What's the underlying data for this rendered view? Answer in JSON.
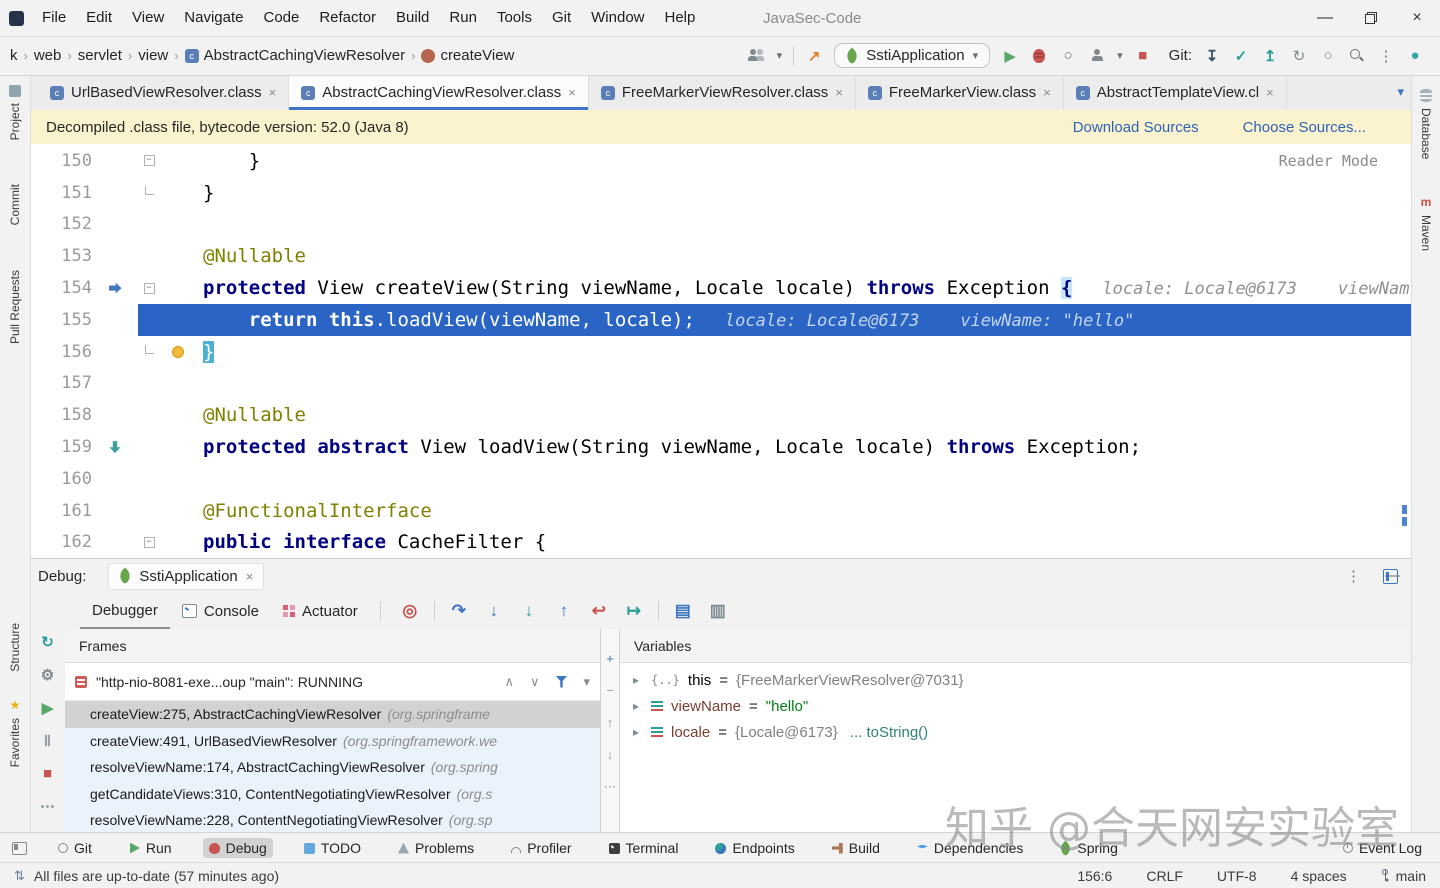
{
  "titlebar": {
    "menus": [
      "File",
      "Edit",
      "View",
      "Navigate",
      "Code",
      "Refactor",
      "Build",
      "Run",
      "Tools",
      "Git",
      "Window",
      "Help"
    ],
    "title": "JavaSec-Code"
  },
  "navbar": {
    "crumbs": [
      {
        "label": "k"
      },
      {
        "label": "web"
      },
      {
        "label": "servlet"
      },
      {
        "label": "view"
      },
      {
        "label": "AbstractCachingViewResolver",
        "icon": "class"
      },
      {
        "label": "createView",
        "icon": "method"
      }
    ],
    "run_config": "SstiApplication",
    "git_label": "Git:"
  },
  "tabs": [
    {
      "label": "UrlBasedViewResolver.class"
    },
    {
      "label": "AbstractCachingViewResolver.class",
      "active": true
    },
    {
      "label": "FreeMarkerViewResolver.class"
    },
    {
      "label": "FreeMarkerView.class"
    },
    {
      "label": "AbstractTemplateView.cl"
    }
  ],
  "banner": {
    "message": "Decompiled .class file, bytecode version: 52.0 (Java 8)",
    "actions": [
      "Download Sources",
      "Choose Sources..."
    ]
  },
  "editor": {
    "reader_mode": "Reader Mode",
    "lines": [
      {
        "num": "150",
        "fold": "minus",
        "tokens": [
          [
            "    }",
            "p"
          ]
        ]
      },
      {
        "num": "151",
        "fold": "end",
        "tokens": [
          [
            "}",
            "p"
          ]
        ]
      },
      {
        "num": "152",
        "tokens": []
      },
      {
        "num": "153",
        "tokens": [
          [
            "@Nullable",
            "ann"
          ]
        ]
      },
      {
        "num": "154",
        "fold": "minus",
        "icon1": "exec",
        "tokens": [
          [
            "protected",
            "kw"
          ],
          [
            " View ",
            "p"
          ],
          [
            "createView",
            "p"
          ],
          [
            "(String viewName, Locale locale) ",
            "p"
          ],
          [
            "throws",
            "kw"
          ],
          [
            " Exception ",
            "p"
          ],
          [
            "{",
            "m1"
          ]
        ],
        "hint": "locale: Locale@6173    viewNam"
      },
      {
        "num": "155",
        "current": true,
        "tokens": [
          [
            "    ",
            "p"
          ],
          [
            "return",
            "kw"
          ],
          [
            " ",
            "p"
          ],
          [
            "this",
            "kw"
          ],
          [
            ".loadView(viewName, locale);",
            "p"
          ]
        ],
        "hint": "locale: Locale@6173    viewName: \"hello\""
      },
      {
        "num": "156",
        "fold": "end",
        "icon2": "bulb",
        "tokens": [
          [
            "}",
            "m2"
          ]
        ]
      },
      {
        "num": "157",
        "tokens": []
      },
      {
        "num": "158",
        "tokens": [
          [
            "@Nullable",
            "ann"
          ]
        ]
      },
      {
        "num": "159",
        "icon1": "impl",
        "tokens": [
          [
            "protected",
            "kw"
          ],
          [
            " ",
            "p"
          ],
          [
            "abstract",
            "kw"
          ],
          [
            " View ",
            "p"
          ],
          [
            "loadView",
            "p"
          ],
          [
            "(String viewName, Locale locale) ",
            "p"
          ],
          [
            "throws",
            "kw"
          ],
          [
            " Exception;",
            "p"
          ]
        ]
      },
      {
        "num": "160",
        "tokens": []
      },
      {
        "num": "161",
        "tokens": [
          [
            "@FunctionalInterface",
            "ann"
          ]
        ]
      },
      {
        "num": "162",
        "fold": "minus",
        "tokens": [
          [
            "public",
            "kw"
          ],
          [
            " ",
            "p"
          ],
          [
            "interface",
            "kw"
          ],
          [
            " CacheFilter {",
            "p"
          ]
        ]
      }
    ]
  },
  "debug": {
    "title": "Debug:",
    "session_tab": "SstiApplication",
    "tabs": [
      {
        "label": "Debugger",
        "active": true
      },
      {
        "label": "Console",
        "icon": "console"
      },
      {
        "label": "Actuator",
        "icon": "actuator"
      }
    ],
    "step_icons": [
      {
        "name": "show-execution-point",
        "g": "◎",
        "c": "#c75450"
      },
      {
        "sep": true
      },
      {
        "name": "step-over",
        "g": "↷",
        "c": "#3b76c0"
      },
      {
        "name": "step-into",
        "g": "↓",
        "c": "#3b76c0"
      },
      {
        "name": "force-step-into",
        "g": "↓",
        "c": "#2e9e97"
      },
      {
        "name": "step-out",
        "g": "↑",
        "c": "#3b76c0"
      },
      {
        "name": "drop-frame",
        "g": "↩",
        "c": "#c75450"
      },
      {
        "name": "run-to-cursor",
        "g": "↦",
        "c": "#2e9e97"
      },
      {
        "sep": true
      },
      {
        "name": "evaluate-expression",
        "g": "▤",
        "c": "#3b76c0"
      },
      {
        "name": "settings-sliders",
        "g": "▥",
        "c": "#7f8b91"
      }
    ],
    "side_icons": [
      {
        "name": "rerun",
        "g": "↻",
        "c": "#2e9e97"
      },
      {
        "name": "settings",
        "g": "⚙",
        "c": "#7f8b91"
      },
      {
        "name": "resume",
        "g": "▶",
        "c": "#59a869"
      },
      {
        "name": "pause",
        "g": "Ⅱ",
        "c": "#9aa0a6"
      },
      {
        "name": "stop",
        "g": "■",
        "c": "#c75450"
      },
      {
        "name": "more",
        "g": "⋯",
        "c": "#7f8b91"
      }
    ],
    "watch_icons": [
      {
        "name": "add-watch",
        "g": "+",
        "c": "#3b76c0"
      },
      {
        "name": "remove-watch",
        "g": "−",
        "c": "#9aa0a6"
      },
      {
        "name": "move-up",
        "g": "↑",
        "c": "#9aa0a6"
      },
      {
        "name": "move-down",
        "g": "↓",
        "c": "#9aa0a6"
      },
      {
        "name": "more",
        "g": "⋯",
        "c": "#9aa0a6"
      }
    ],
    "frames": {
      "header": "Frames",
      "thread": "\"http-nio-8081-exe...oup \"main\": RUNNING",
      "rows": [
        {
          "loc": "createView:275, AbstractCachingViewResolver",
          "pkg": "(org.springframe",
          "selected": true
        },
        {
          "loc": "createView:491, UrlBasedViewResolver",
          "pkg": "(org.springframework.we"
        },
        {
          "loc": "resolveViewName:174, AbstractCachingViewResolver",
          "pkg": "(org.spring"
        },
        {
          "loc": "getCandidateViews:310, ContentNegotiatingViewResolver",
          "pkg": "(org.s"
        },
        {
          "loc": "resolveViewName:228, ContentNegotiatingViewResolver",
          "pkg": "(org.sp"
        }
      ]
    },
    "variables": {
      "header": "Variables",
      "rows": [
        {
          "icon": "object",
          "name": "this",
          "value": "{FreeMarkerViewResolver@7031}",
          "vclass": "val-ref"
        },
        {
          "icon": "field",
          "name": "viewName",
          "value": "\"hello\"",
          "vclass": "val-string"
        },
        {
          "icon": "field",
          "name": "locale",
          "value": "{Locale@6173}",
          "vclass": "val-ref",
          "extra": "... toString()"
        }
      ]
    }
  },
  "toolbar_bottom": {
    "items": [
      {
        "label": "Git",
        "icon": "git"
      },
      {
        "label": "Run",
        "icon": "run"
      },
      {
        "label": "Debug",
        "icon": "debug",
        "active": true
      },
      {
        "label": "TODO",
        "icon": "todo"
      },
      {
        "label": "Problems",
        "icon": "problems"
      },
      {
        "label": "Profiler",
        "icon": "profiler"
      },
      {
        "label": "Terminal",
        "icon": "terminal"
      },
      {
        "label": "Endpoints",
        "icon": "endpoints"
      },
      {
        "label": "Build",
        "icon": "build"
      },
      {
        "label": "Dependencies",
        "icon": "dependencies"
      },
      {
        "label": "Spring",
        "icon": "spring"
      },
      {
        "label": "Event Log",
        "icon": "eventlog",
        "right": true
      }
    ]
  },
  "statusbar": {
    "left": "All files are up-to-date (57 minutes ago)",
    "right": [
      "156:6",
      "CRLF",
      "UTF-8",
      "4 spaces"
    ],
    "branch": "main"
  },
  "left_rail": {
    "top": [
      "Project",
      "Commit",
      "Pull Requests"
    ],
    "bottom": [
      "Structure",
      "Favorites"
    ]
  },
  "right_rail": [
    "Database",
    "Maven"
  ],
  "watermark": "知乎 @合天网安实验室",
  "glyphs": {
    "minimize": "–",
    "close": "×",
    "chevron_down": "▾",
    "chevron_right": "▸",
    "kebab": "⋮",
    "hide": "—",
    "crumb_sep": "›",
    "class_badge": "c",
    "maven_badge": "m",
    "play": "▶",
    "stop": "■",
    "up": "∧",
    "down": "∨",
    "download": "↧",
    "push": "↥",
    "check": "✓",
    "rerun": "↻",
    "ring": "○",
    "circle": "●",
    "arrow_ne": "↗",
    "updown": "⇅",
    "star": "★",
    "obj_icon": "{..}"
  },
  "colors": {
    "accent_blue": "#3b76c0",
    "execution_line_blue": "#2a65c5",
    "banner_yellow": "#fbf3cd",
    "link_blue": "#2c63b8",
    "keyword_navy": "#000080",
    "annotation_olive": "#808000",
    "string_green": "#067d17",
    "frame_selected_gray": "#d2d2d2",
    "frame_row_blue": "#eaf3fb",
    "spring_green": "#68a64d",
    "stop_red": "#c75450",
    "teal": "#2e9e97"
  }
}
